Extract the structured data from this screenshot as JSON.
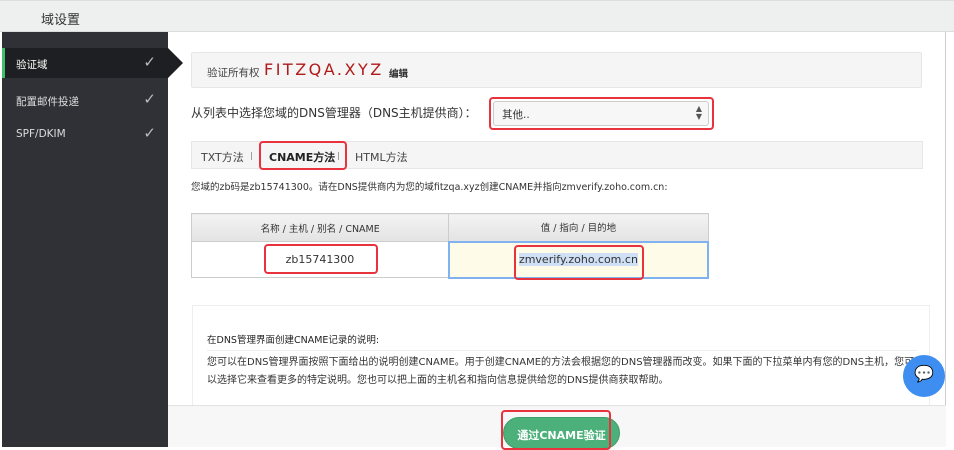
{
  "header": {
    "title": "域设置"
  },
  "sidebar": {
    "items": [
      {
        "label": "验证域",
        "active": true
      },
      {
        "label": "配置邮件投递"
      },
      {
        "label": "SPF/DKIM"
      }
    ],
    "check_icon": "✓"
  },
  "ownership": {
    "label": "验证所有权",
    "domain": "FITZQA.XYZ",
    "edit": "编辑"
  },
  "dns_question": "从列表中选择您域的DNS管理器（DNS主机提供商）：",
  "dns_select": {
    "value": "其他.."
  },
  "tabs": [
    {
      "label": "TXT方法"
    },
    {
      "label": "CNAME方法",
      "active": true
    },
    {
      "label": "HTML方法"
    }
  ],
  "info": "您域的zb码是zb15741300。请在DNS提供商内为您的域fitzqa.xyz创建CNAME并指向zmverify.zoho.com.cn:",
  "table": {
    "headers": [
      "名称 / 主机 / 别名 / CNAME",
      "值 / 指向 / 目的地"
    ],
    "row": [
      "zb15741300",
      "zmverify.zoho.com.cn"
    ]
  },
  "description": {
    "title": "在DNS管理界面创建CNAME记录的说明:",
    "text": "您可以在DNS管理界面按照下面给出的说明创建CNAME。用于创建CNAME的方法会根据您的DNS管理器而改变。如果下面的下拉菜单内有您的DNS主机，您可以选择它来查看更多的特定说明。您也可以把上面的主机名和指向信息提供给您的DNS提供商获取帮助。"
  },
  "verify_button": "通过CNAME验证",
  "colors": {
    "accent": "#4cb07a",
    "highlight": "#e8333f",
    "domain": "#b01a1a"
  }
}
